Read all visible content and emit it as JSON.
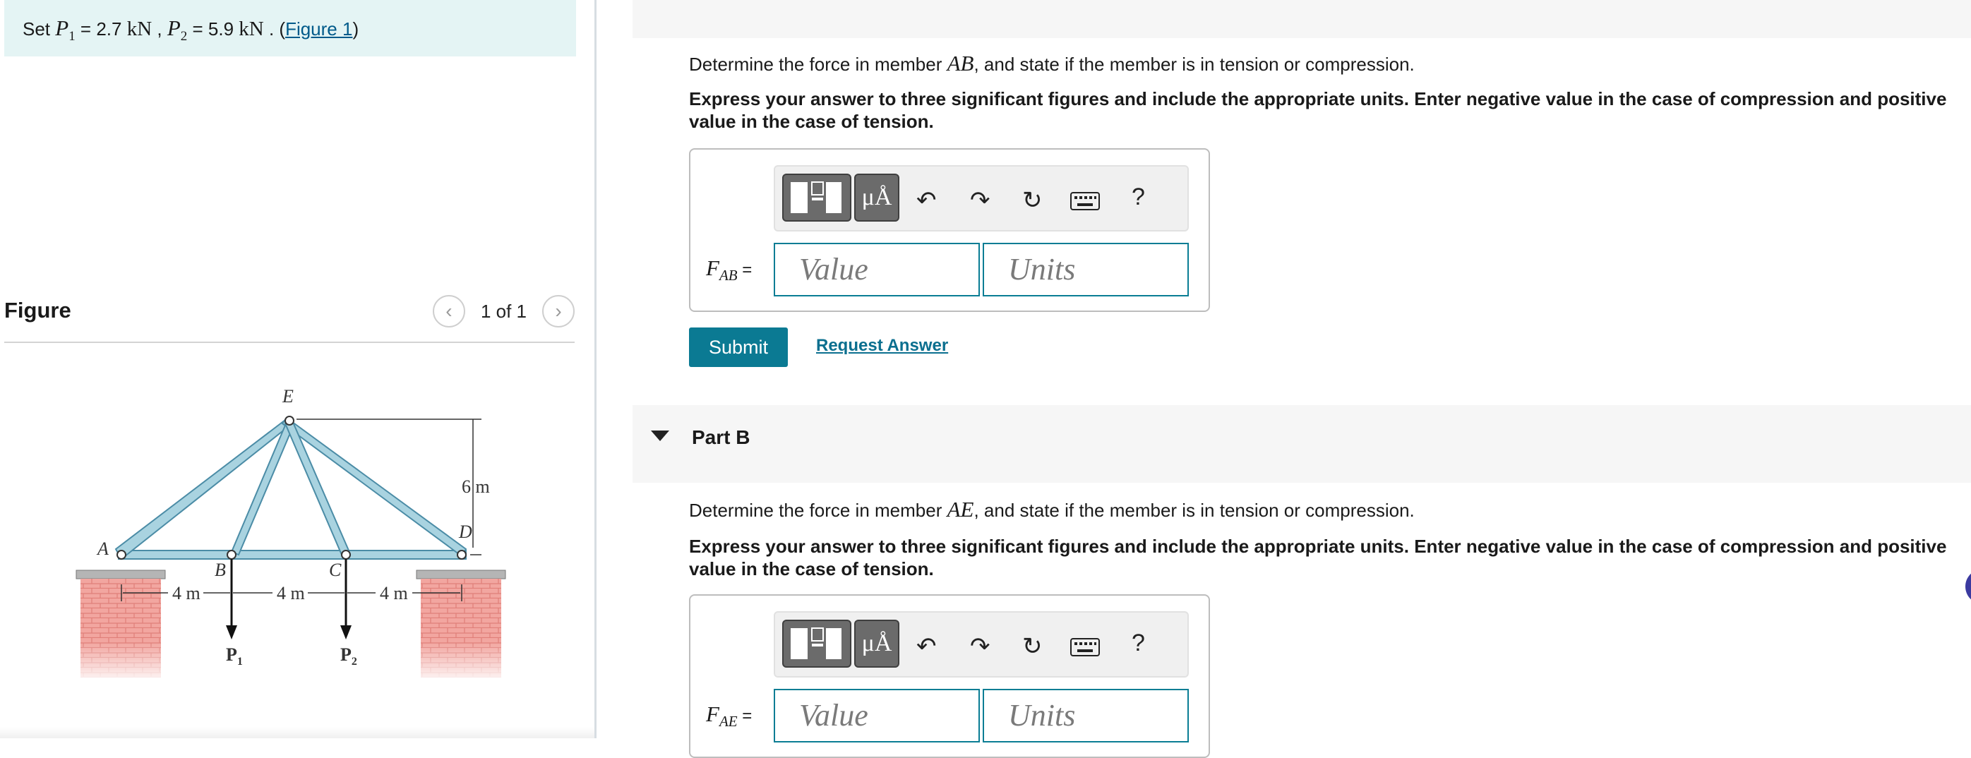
{
  "problem": {
    "set_prefix": "Set",
    "p1_sym": "P",
    "p1_sub": "1",
    "p1_val": " = 2.7 ",
    "p1_unit": "kN",
    "sep": " , ",
    "p2_sym": "P",
    "p2_sub": "2",
    "p2_val": " = 5.9 ",
    "p2_unit": "kN",
    "end": " . (",
    "figure_link": "Figure 1",
    "close": ")"
  },
  "figure_panel": {
    "title": "Figure",
    "counter": "1 of 1",
    "prev_icon": "chevron-left-icon",
    "next_icon": "chevron-right-icon",
    "labels": {
      "A": "A",
      "B": "B",
      "C": "C",
      "D": "D",
      "E": "E",
      "height": "6 m",
      "span1": "4 m",
      "span2": "4 m",
      "span3": "4 m",
      "load1": "P",
      "load1_sub": "1",
      "load2": "P",
      "load2_sub": "2"
    },
    "colors": {
      "member": "#a9d3e0",
      "member_edge": "#4b8ca6",
      "brick": "#f2a6a0",
      "support": "#9a9a9a"
    }
  },
  "part_a": {
    "question_pre": "Determine the force in member ",
    "member": "AB",
    "question_post": ", and state if the member is in tension or compression.",
    "instructions": "Express your answer to three significant figures and include the appropriate units. Enter negative value in the case of compression and positive value in the case of tension.",
    "label_var": "F",
    "label_sub": "AB",
    "label_eq": " =",
    "value_placeholder": "Value",
    "units_placeholder": "Units",
    "submit": "Submit",
    "request": "Request Answer"
  },
  "part_b": {
    "header": "Part B",
    "question_pre": "Determine the force in member ",
    "member": "AE",
    "question_post": ", and state if the member is in tension or compression.",
    "instructions": "Express your answer to three significant figures and include the appropriate units. Enter negative value in the case of compression and positive value in the case of tension.",
    "label_var": "F",
    "label_sub": "AE",
    "label_eq": " =",
    "value_placeholder": "Value",
    "units_placeholder": "Units"
  },
  "toolbar": {
    "units_btn": "μÅ",
    "help": "?",
    "icons": [
      "templates-icon",
      "units-icon",
      "undo-icon",
      "redo-icon",
      "reset-icon",
      "keyboard-icon",
      "help-icon"
    ]
  },
  "colors": {
    "accent": "#0b7a93",
    "setbar_bg": "#e4f4f4",
    "link": "#005a8a"
  }
}
